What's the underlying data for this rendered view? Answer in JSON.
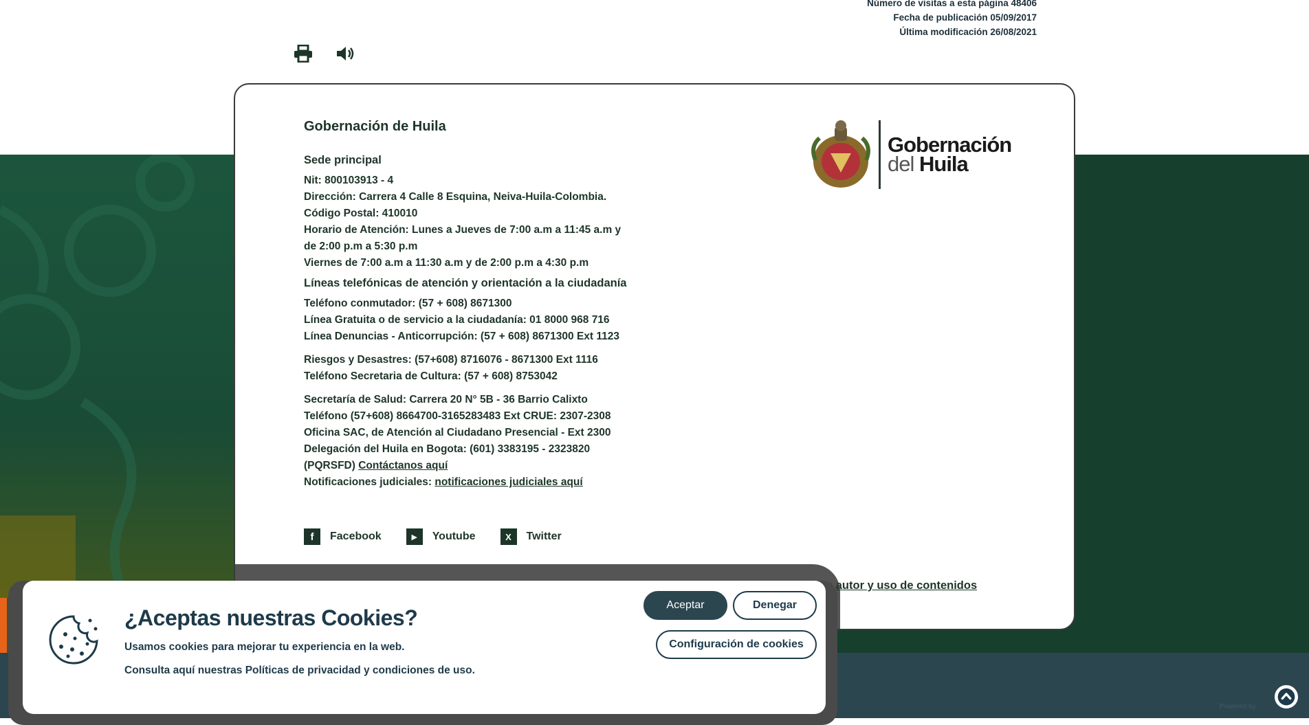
{
  "meta": {
    "visits": "Número de visitas a esta página 48406",
    "published": "Fecha de publicación 05/09/2017",
    "modified": "Última modificación 26/08/2021"
  },
  "tools": {
    "print_icon": "printer-icon",
    "audio_icon": "speaker-icon"
  },
  "footer_info": {
    "org_title": "Gobernación de Huila",
    "sede_title": "Sede principal",
    "nit": "Nit: 800103913 - 4",
    "direccion": "Dirección: Carrera 4 Calle 8 Esquina, Neiva-Huila-Colombia.",
    "codigo_postal": "Código Postal: 410010",
    "horario_1": "Horario de Atención: Lunes a Jueves de 7:00 a.m a 11:45 a.m y",
    "horario_2": "de 2:00 p.m a 5:30 p.m",
    "horario_3": "Viernes de 7:00 a.m a 11:30 a.m y de 2:00 p.m a 4:30 p.m",
    "lineas_title": "Líneas telefónicas de atención y orientación a la ciudadanía",
    "conmutador": "Teléfono conmutador: (57 + 608) 8671300",
    "gratuita": "Línea Gratuita o de servicio a la ciudadanía: 01 8000 968 716",
    "denuncias": "Línea Denuncias - Anticorrupción: (57 + 608) 8671300 Ext 1123",
    "riesgos": "Riesgos y Desastres: (57+608) 8716076 - 8671300 Ext 1116",
    "cultura": "Teléfono Secretaria de Cultura: (57 + 608) 8753042",
    "salud": "Secretaría de Salud: Carrera 20 N° 5B - 36 Barrio Calixto",
    "salud_tel": "Teléfono (57+608) 8664700-3165283483 Ext CRUE: 2307-2308",
    "sac": "Oficina SAC, de Atención al Ciudadano Presencial - Ext 2300",
    "bogota": "Delegación del Huila en Bogota: (601) 3383195 - 2323820",
    "pqrsfd_prefix": "(PQRSFD)",
    "pqrsfd_link": "Contáctanos aquí",
    "notif_prefix": "Notificaciones judiciales:",
    "notif_link": "notificaciones judiciales aquí",
    "derechos_link": "e autor y uso de contenidos"
  },
  "socials": [
    {
      "label": "Facebook",
      "icon": "facebook-icon",
      "glyph": "f"
    },
    {
      "label": "Youtube",
      "icon": "youtube-icon",
      "glyph": "▶"
    },
    {
      "label": "Twitter",
      "icon": "x-twitter-icon",
      "glyph": "X"
    }
  ],
  "logo": {
    "line1": "Gobernación",
    "line2_thin": "del",
    "line2_bold": "Huila"
  },
  "cookies": {
    "title": "¿Aceptas nuestras Cookies?",
    "text1": "Usamos cookies para mejorar tu experiencia en la web.",
    "text2": "Consulta aquí nuestras Políticas de privacidad y condiciones de uso.",
    "accept": "Aceptar",
    "deny": "Denegar",
    "config": "Configuración de cookies"
  },
  "powered": "Powered by",
  "colors": {
    "green": "#163f2e",
    "footer": "#2c4650",
    "accent": "#e8631a",
    "text": "#1d3528"
  }
}
